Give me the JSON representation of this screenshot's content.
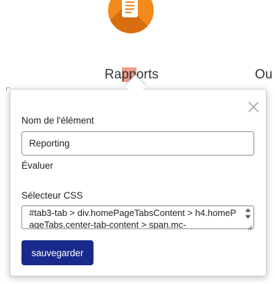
{
  "background": {
    "icon": "report-document-icon",
    "accent_color": "#f28a1c",
    "tab_label_start": "Ra",
    "tab_label_highlight": "pp",
    "tab_label_end": "orts",
    "next_tab_label": "Ou",
    "highlight_color": "#ed9d8a"
  },
  "popover": {
    "close_icon": "close-icon",
    "name_label": "Nom de l'élément",
    "name_value": "Reporting",
    "evaluate_label": "Évaluer",
    "css_selector_label": "Sélecteur CSS",
    "css_selector_value": "#tab3-tab > div.homePageTabsContent > h4.homePageTabs.center-tab-content > span.mc-",
    "save_label": "sauvegarder",
    "save_button_color": "#1a2a8c"
  }
}
